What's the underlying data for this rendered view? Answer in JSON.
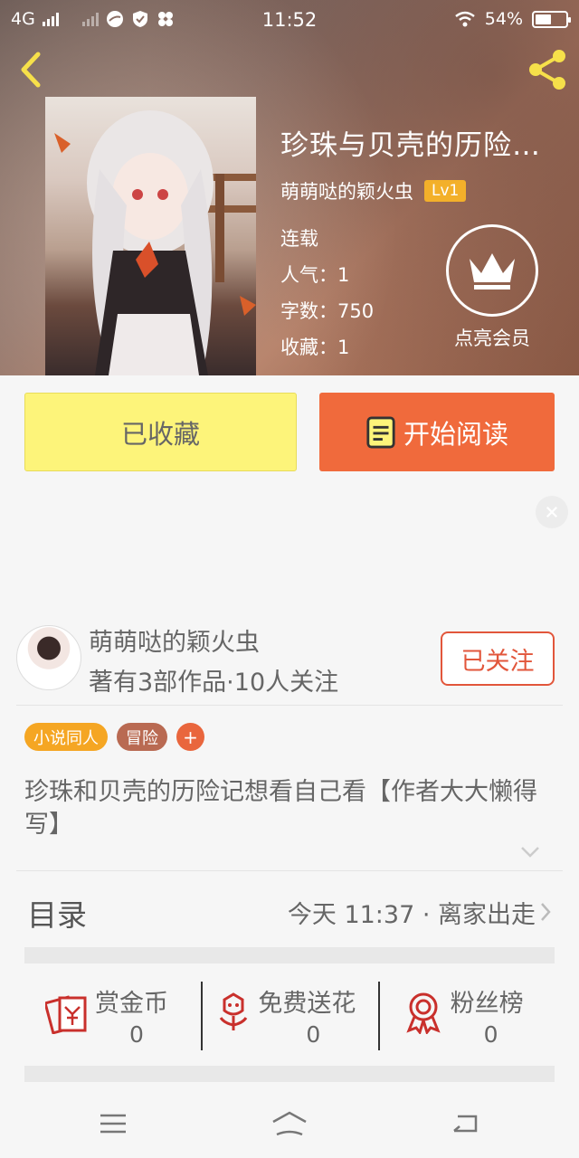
{
  "status_bar": {
    "network": "4G",
    "time": "11:52",
    "battery": "54%",
    "battery_level": 0.54
  },
  "book": {
    "title": "珍珠与贝壳的历险…",
    "author": "萌萌哒的颖火虫",
    "level": "Lv1",
    "status": "连载",
    "popularity": "人气：1",
    "word_count": "字数：750",
    "favorites": "收藏：1"
  },
  "vip": {
    "label": "点亮会员"
  },
  "actions": {
    "favorite_label": "已收藏",
    "read_label": "开始阅读"
  },
  "author_card": {
    "name": "萌萌哒的颖火虫",
    "stats": "著有3部作品·10人关注",
    "follow_label": "已关注"
  },
  "tags": [
    {
      "label": "小说同人"
    },
    {
      "label": "冒险"
    },
    {
      "label": "+"
    }
  ],
  "summary": "珍珠和贝壳的历险记想看自己看【作者大大懒得写】",
  "toc": {
    "title": "目录",
    "latest": "今天 11:37 · 离家出走"
  },
  "rewards": [
    {
      "label": "赏金币",
      "count": "0",
      "icon": "red-envelope-icon"
    },
    {
      "label": "免费送花",
      "count": "0",
      "icon": "flower-icon"
    },
    {
      "label": "粉丝榜",
      "count": "0",
      "icon": "medal-icon"
    }
  ],
  "colors": {
    "accent_orange": "#f06a3c",
    "favorite_yellow": "#fdf47a",
    "level_badge": "#f3b02a",
    "follow_red": "#e2563b"
  }
}
